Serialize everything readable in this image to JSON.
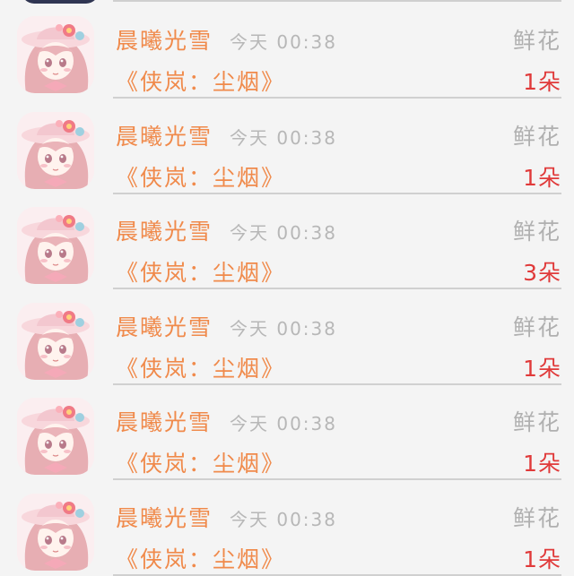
{
  "colors": {
    "name": "#f08a4b",
    "time": "#b7b7b7",
    "gift_type": "#b0b0b0",
    "count": "#e03a3a",
    "background": "#f4f4f4",
    "divider": "#d0d0d0"
  },
  "gift_records": [
    {
      "sender": "晨曦光雪",
      "date": "今天",
      "time": "00:38",
      "gift_type": "鲜花",
      "target": "《侠岚：尘烟》",
      "count": "1朵",
      "avatar_icon": "anime-girl-avatar"
    },
    {
      "sender": "晨曦光雪",
      "date": "今天",
      "time": "00:38",
      "gift_type": "鲜花",
      "target": "《侠岚：尘烟》",
      "count": "1朵",
      "avatar_icon": "anime-girl-avatar"
    },
    {
      "sender": "晨曦光雪",
      "date": "今天",
      "time": "00:38",
      "gift_type": "鲜花",
      "target": "《侠岚：尘烟》",
      "count": "3朵",
      "avatar_icon": "anime-girl-avatar"
    },
    {
      "sender": "晨曦光雪",
      "date": "今天",
      "time": "00:38",
      "gift_type": "鲜花",
      "target": "《侠岚：尘烟》",
      "count": "1朵",
      "avatar_icon": "anime-girl-avatar"
    },
    {
      "sender": "晨曦光雪",
      "date": "今天",
      "time": "00:38",
      "gift_type": "鲜花",
      "target": "《侠岚：尘烟》",
      "count": "1朵",
      "avatar_icon": "anime-girl-avatar"
    },
    {
      "sender": "晨曦光雪",
      "date": "今天",
      "time": "00:38",
      "gift_type": "鲜花",
      "target": "《侠岚：尘烟》",
      "count": "1朵",
      "avatar_icon": "anime-girl-avatar"
    }
  ]
}
